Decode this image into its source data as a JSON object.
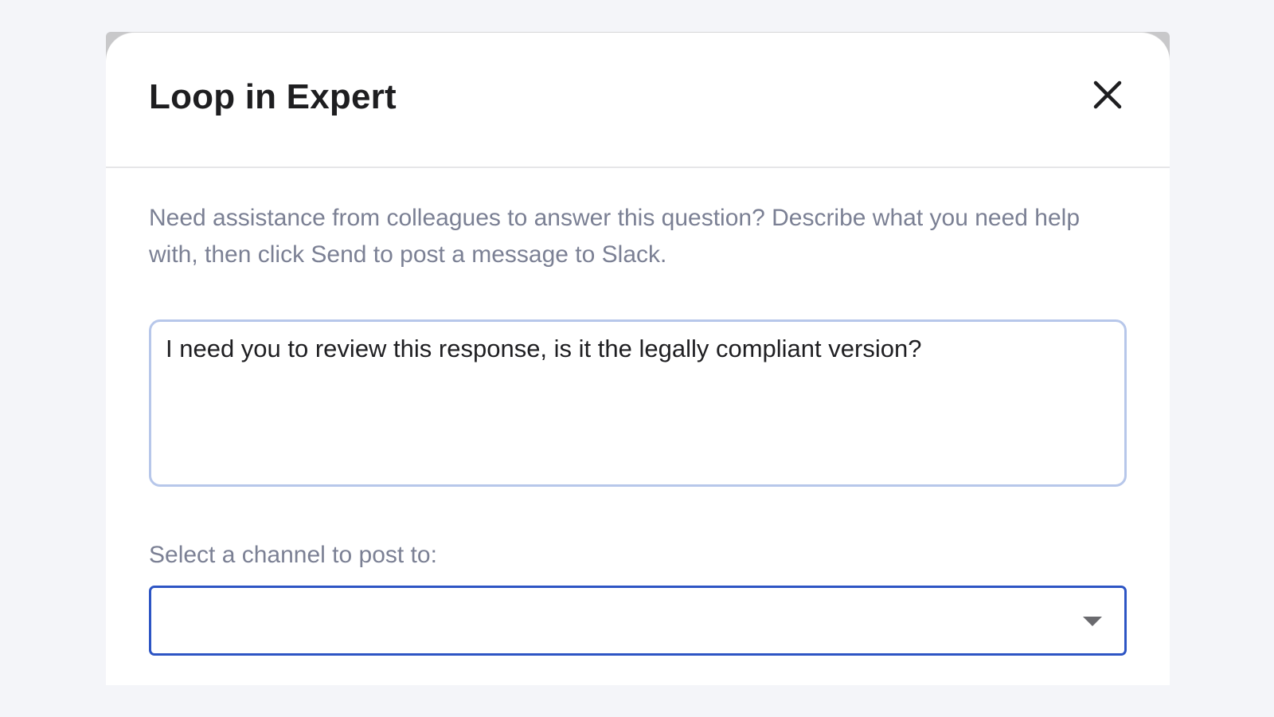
{
  "modal": {
    "title": "Loop in Expert",
    "close_icon": "close-icon"
  },
  "body": {
    "description": "Need assistance from colleagues to answer this question? Describe what you need help with, then click Send to post a message to Slack.",
    "message": {
      "value": "I need you to review this response, is it the legally compliant version?",
      "placeholder": ""
    },
    "channel": {
      "label": "Select a channel to post to:",
      "selected": "",
      "dropdown_icon": "chevron-down-icon"
    }
  },
  "colors": {
    "page_background": "#f4f5f9",
    "title_text": "#1e1e20",
    "muted_text": "#7b8094",
    "textarea_border": "#b7c7ea",
    "select_border_focus": "#2d55c4"
  }
}
